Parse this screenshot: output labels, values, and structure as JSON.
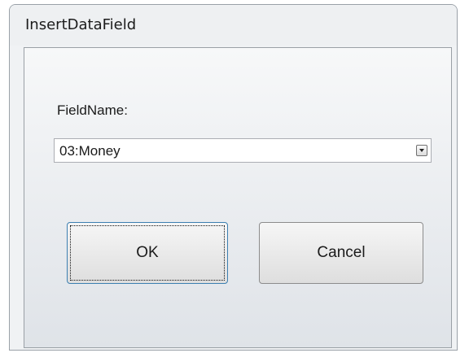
{
  "window": {
    "title": "InsertDataField"
  },
  "form": {
    "field_label": "FieldName:",
    "field_select": {
      "selected": "03:Money"
    }
  },
  "buttons": {
    "ok_label": "OK",
    "cancel_label": "Cancel"
  },
  "icons": {
    "dropdown": "chevron-down-icon"
  }
}
